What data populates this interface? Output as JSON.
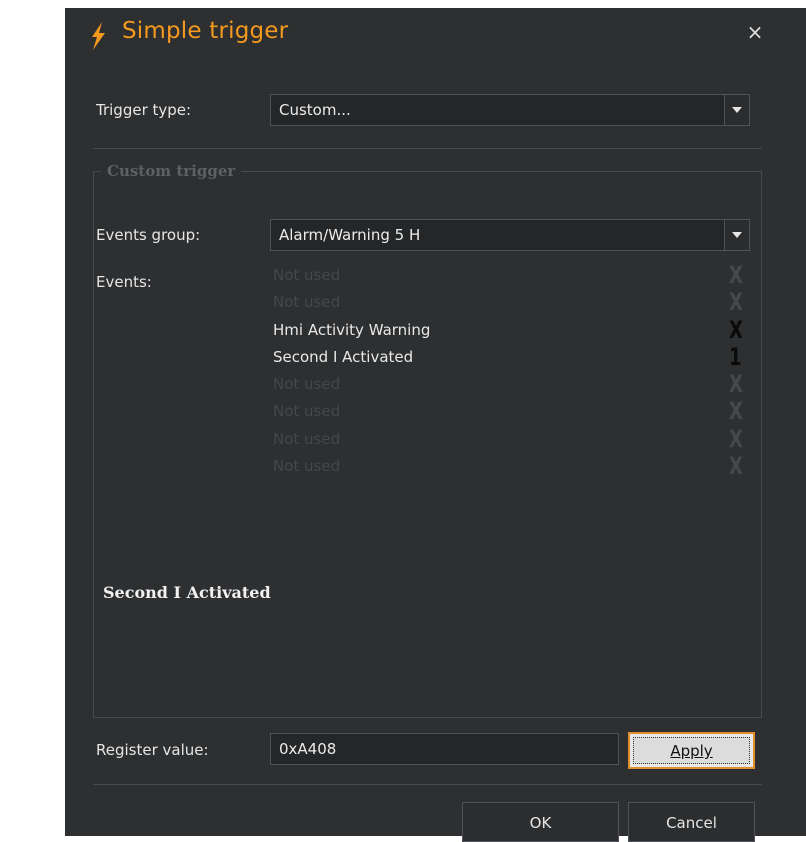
{
  "dialog": {
    "title": "Simple trigger",
    "close_symbol": "×",
    "accent_color": "#f39a1e"
  },
  "trigger_type": {
    "label": "Trigger type:",
    "value": "Custom..."
  },
  "custom_trigger": {
    "group_title": "Custom trigger",
    "events_group_label": "Events group:",
    "events_group_value": "Alarm/Warning 5 H",
    "events_label": "Events:",
    "events": [
      {
        "name": "Not used",
        "mark": "X",
        "used": false
      },
      {
        "name": "Not used",
        "mark": "X",
        "used": false
      },
      {
        "name": "Hmi Activity Warning",
        "mark": "X",
        "used": true
      },
      {
        "name": "Second I Activated",
        "mark": "1",
        "used": true
      },
      {
        "name": "Not used",
        "mark": "X",
        "used": false
      },
      {
        "name": "Not used",
        "mark": "X",
        "used": false
      },
      {
        "name": "Not used",
        "mark": "X",
        "used": false
      },
      {
        "name": "Not used",
        "mark": "X",
        "used": false
      }
    ],
    "selected_description": "Second I Activated"
  },
  "register": {
    "label": "Register value:",
    "value": "0xA408",
    "apply_label": "Apply"
  },
  "footer": {
    "ok_label": "OK",
    "cancel_label": "Cancel"
  },
  "icons": {
    "title": "lightning-icon",
    "close": "close-icon",
    "dropdown": "chevron-down-icon"
  }
}
